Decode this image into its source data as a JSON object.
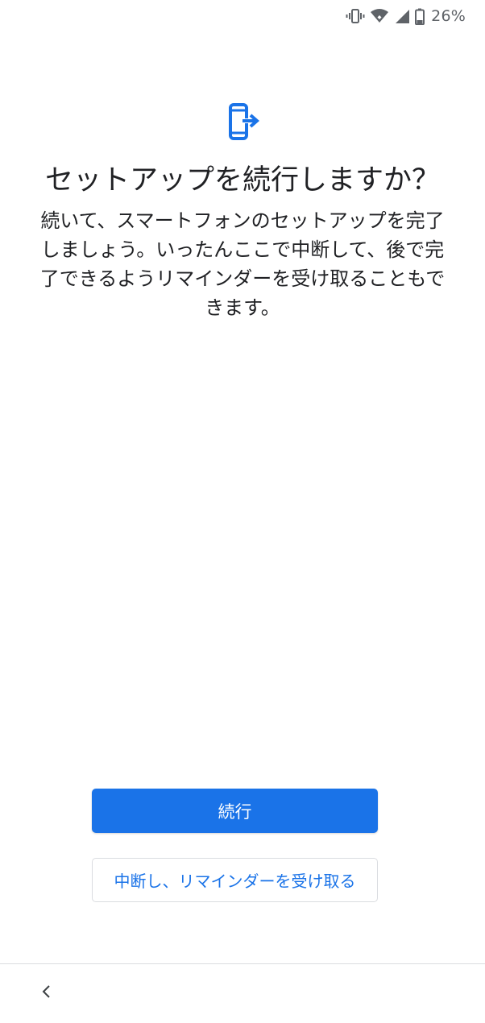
{
  "status_bar": {
    "vibrate_icon": "vibrate-icon",
    "wifi_icon": "wifi-icon",
    "signal_icon": "cell-signal-icon",
    "battery_icon": "battery-icon",
    "battery_percent": "26%"
  },
  "header": {
    "icon": "phone-exit-icon",
    "title": "セットアップを続行しますか？"
  },
  "body": {
    "description": "続いて、スマートフォンのセットアップを完了しましょう。いったんここで中断して、後で完了できるようリマインダーを受け取ることもできます。"
  },
  "actions": {
    "continue_label": "続行",
    "pause_label": "中断し、リマインダーを受け取る"
  },
  "nav": {
    "back_icon": "chevron-left-icon"
  },
  "colors": {
    "accent": "#1a73e8",
    "text": "#202124",
    "divider": "#dadce0"
  }
}
